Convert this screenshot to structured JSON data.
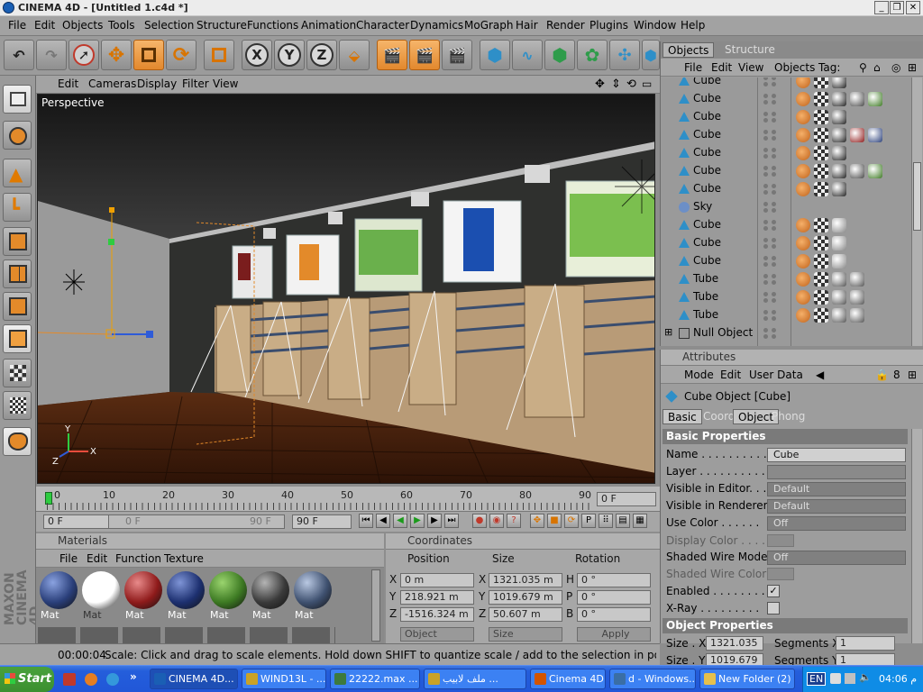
{
  "app": {
    "title": "CINEMA 4D - [Untitled 1.c4d *]",
    "win_min": "_",
    "win_max": "❐",
    "win_close": "✕"
  },
  "menubar": [
    "File",
    "Edit",
    "Objects",
    "Tools",
    "Selection",
    "Structure",
    "Functions",
    "Animation",
    "Character",
    "Dynamics",
    "MoGraph",
    "Hair",
    "Render",
    "Plugins",
    "Window",
    "Help"
  ],
  "toolbar": {
    "axis_x": "X",
    "axis_y": "Y",
    "axis_z": "Z"
  },
  "viewport": {
    "menu": [
      "Edit",
      "Cameras",
      "Display",
      "Filter",
      "View"
    ],
    "label": "Perspective"
  },
  "timeline": {
    "ticks": [
      "0",
      "10",
      "20",
      "30",
      "40",
      "50",
      "60",
      "70",
      "80",
      "90"
    ],
    "current_frame": "0 F",
    "start_field": "0 F",
    "range_start": "0 F",
    "range_end": "90 F",
    "end_field": "90 F"
  },
  "materials": {
    "header": "Materials",
    "menu": [
      "File",
      "Edit",
      "Function",
      "Texture"
    ],
    "items": [
      {
        "label": "Mat",
        "color": "#2a3f7a",
        "hi": "#8aa2e0"
      },
      {
        "label": "Mat",
        "color": "#ffffff",
        "hi": "#ffffff"
      },
      {
        "label": "Mat",
        "color": "#8f1b1b",
        "hi": "#e88a8a"
      },
      {
        "label": "Mat",
        "color": "#1d3070",
        "hi": "#7e94d6"
      },
      {
        "label": "Mat",
        "color": "#3d7a23",
        "hi": "#9ad46e"
      },
      {
        "label": "Mat",
        "color": "#3a3a3a",
        "hi": "#b4b4b4"
      },
      {
        "label": "Mat",
        "color": "#3f5170",
        "hi": "#b9c8e2"
      }
    ]
  },
  "coordinates": {
    "header": "Coordinates",
    "col_position": "Position",
    "col_size": "Size",
    "col_rotation": "Rotation",
    "pos_x_label": "X",
    "pos_x": "0 m",
    "pos_y_label": "Y",
    "pos_y": "218.921 m",
    "pos_z_label": "Z",
    "pos_z": "-1516.324 m",
    "size_x_label": "X",
    "size_x": "1321.035 m",
    "size_y_label": "Y",
    "size_y": "1019.679 m",
    "size_z_label": "Z",
    "size_z": "50.607 m",
    "rot_h_label": "H",
    "rot_h": "0 °",
    "rot_p_label": "P",
    "rot_p": "0 °",
    "rot_b_label": "B",
    "rot_b": "0 °",
    "mode": "Object",
    "size_mode": "Size",
    "apply": "Apply"
  },
  "objects_panel": {
    "tab_objects": "Objects",
    "tab_structure": "Structure",
    "menu": [
      "File",
      "Edit",
      "View",
      "Objects",
      "Tag:"
    ],
    "rows": [
      "Cube",
      "Cube",
      "Cube",
      "Cube",
      "Cube",
      "Cube",
      "Cube",
      "Sky",
      "Cube",
      "Cube",
      "Cube",
      "Tube",
      "Tube",
      "Tube",
      "Null Object"
    ]
  },
  "attributes": {
    "header": "Attributes",
    "menu": [
      "Mode",
      "Edit",
      "User Data"
    ],
    "object_title": "Cube Object [Cube]",
    "tabs": [
      "Basic",
      "Coord.",
      "Object",
      "Phong"
    ],
    "section_basic": "Basic Properties",
    "name_label": "Name . . . . . . . . . .",
    "name_value": "Cube",
    "layer_label": "Layer . . . . . . . . . .",
    "vis_editor_label": "Visible in Editor. . .",
    "vis_editor_value": "Default",
    "vis_renderer_label": "Visible in Renderer .",
    "vis_renderer_value": "Default",
    "use_color_label": "Use Color . . . . . .",
    "use_color_value": "Off",
    "display_color_label": "Display Color . . . .",
    "shaded_wire_mode_label": "Shaded Wire Mode",
    "shaded_wire_mode_value": "Off",
    "shaded_wire_color_label": "Shaded Wire Color",
    "enabled_label": "Enabled . . . . . . . .",
    "enabled_check": "✓",
    "xray_label": "X-Ray . . . . . . . . .",
    "section_object": "Object Properties",
    "size_x_label": "Size . X",
    "size_x_value": "1321.035",
    "segments_x_label": "Segments X",
    "segments_x_value": "1",
    "size_y_label": "Size . Y",
    "size_y_value": "1019.679",
    "segments_y_label": "Segments Y",
    "segments_y_value": "1"
  },
  "status": {
    "time": "00:00:04",
    "message": "Scale: Click and drag to scale elements. Hold down SHIFT to quantize scale / add to the selection in point mode, CTRL to remove"
  },
  "maxon": "MAXON CINEMA 4D",
  "taskbar": {
    "start": "Start",
    "tasks": [
      {
        "label": "CINEMA 4D...",
        "color": "#1a5fb4"
      },
      {
        "label": "WIND13L - ...",
        "color": "#c9a227"
      },
      {
        "label": "22222.max ...",
        "color": "#3d7a3d"
      },
      {
        "label": "ملف لابيب ...",
        "color": "#c9a227"
      },
      {
        "label": "Cinema 4D -...",
        "color": "#d35400"
      },
      {
        "label": "d - Windows...",
        "color": "#3a6ea5"
      },
      {
        "label": "New Folder (2)",
        "color": "#e5c04d"
      }
    ],
    "lang": "EN",
    "clock": "04:06 م"
  }
}
